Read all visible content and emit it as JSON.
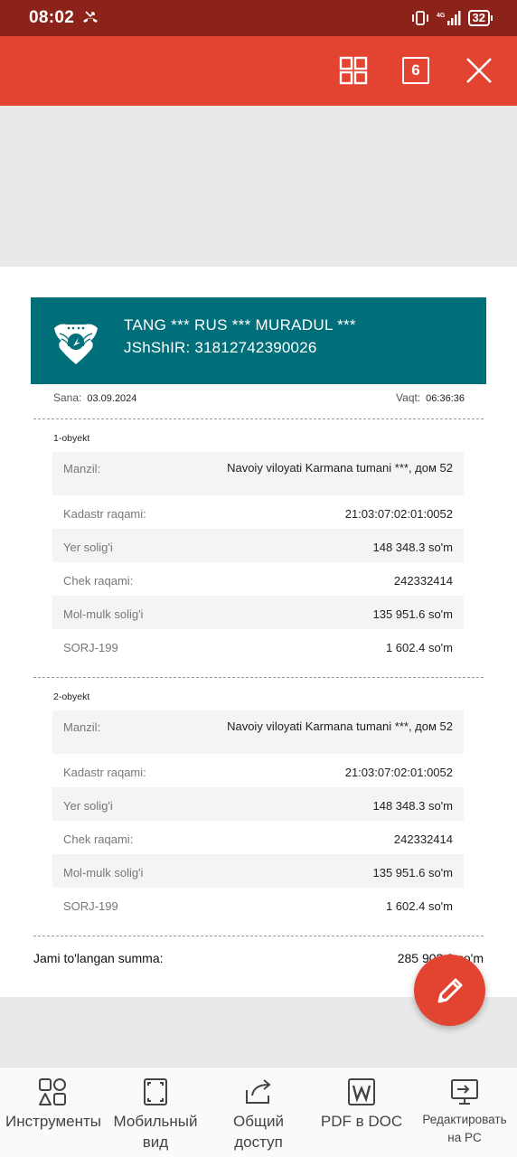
{
  "status_bar": {
    "time": "08:02",
    "signal": "4G",
    "battery": "32",
    "icons": [
      "missed-call-icon",
      "vibrate-icon",
      "signal-icon",
      "battery-icon"
    ]
  },
  "toolbar": {
    "tabs_count": "6",
    "icons": [
      "grid-view-icon",
      "tabs-count-icon",
      "close-icon"
    ]
  },
  "document": {
    "header": {
      "name": "TANG *** RUS ***  MURADUL ***",
      "pin": "JShShIR: 31812742390026",
      "logo": "emblem-logo"
    },
    "date_label": "Sana:",
    "date_value": "03.09.2024",
    "time_label": "Vaqt:",
    "time_value": "06:36:36",
    "objects": [
      {
        "title": "1-obyekt",
        "rows": [
          {
            "label": "Manzil:",
            "value": "Navoiy viloyati Karmana tumani ***, дом 52"
          },
          {
            "label": "Kadastr raqami:",
            "value": "21:03:07:02:01:0052"
          },
          {
            "label": "Yer solig'i",
            "value": "148 348.3 so'm"
          },
          {
            "label": "Chek raqami:",
            "value": "242332414"
          },
          {
            "label": "Mol-mulk solig'i",
            "value": "135 951.6 so'm"
          },
          {
            "label": "SORJ-199",
            "value": "1 602.4 so'm"
          }
        ]
      },
      {
        "title": "2-obyekt",
        "rows": [
          {
            "label": "Manzil:",
            "value": "Navoiy viloyati Karmana tumani ***, дом 52"
          },
          {
            "label": "Kadastr raqami:",
            "value": "21:03:07:02:01:0052"
          },
          {
            "label": "Yer solig'i",
            "value": "148 348.3 so'm"
          },
          {
            "label": "Chek raqami:",
            "value": "242332414"
          },
          {
            "label": "Mol-mulk solig'i",
            "value": "135 951.6 so'm"
          },
          {
            "label": "SORJ-199",
            "value": "1 602.4 so'm"
          }
        ]
      }
    ],
    "total_label": "Jami to'langan summa:",
    "total_value": "285 902.9 so'm"
  },
  "fab": {
    "icon": "pencil-icon"
  },
  "bottom_bar": {
    "items": [
      {
        "label": "Инструменты",
        "icon": "tools-icon"
      },
      {
        "label": "Мобильный вид",
        "icon": "mobile-view-icon"
      },
      {
        "label": "Общий доступ",
        "icon": "share-icon"
      },
      {
        "label": "PDF в DOC",
        "icon": "word-doc-icon"
      },
      {
        "label": "Редактировать на PC",
        "icon": "edit-on-pc-icon"
      }
    ]
  }
}
